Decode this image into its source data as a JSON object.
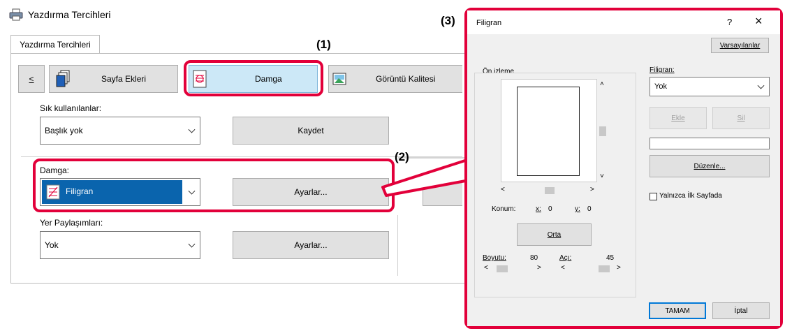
{
  "left_window": {
    "title": "Yazdırma Tercihleri",
    "tab": "Yazdırma Tercihleri",
    "nav_back": "<",
    "tool_tabs": [
      "Sayfa Ekleri",
      "Damga",
      "Görüntü Kalitesi"
    ],
    "favorites_label": "Sık kullanılanlar:",
    "favorites_value": "Başlık yok",
    "save_button": "Kaydet",
    "stamp_label": "Damga:",
    "stamp_value": "Filigran",
    "stamp_settings_button": "Ayarlar...",
    "overlays_label": "Yer Paylaşımları:",
    "overlays_value": "Yok",
    "overlays_settings_button": "Ayarlar..."
  },
  "callouts": {
    "c1": "(1)",
    "c2": "(2)",
    "c3": "(3)"
  },
  "dialog": {
    "title": "Filigran",
    "help": "?",
    "close": "×",
    "defaults_button": "Varsayılanlar",
    "preview_label": "Ön izleme",
    "position_label": "Konum:",
    "x_label": "x:",
    "x_value": "0",
    "y_label": "y:",
    "y_value": "0",
    "center_button": "Orta",
    "size_label": "Boyutu:",
    "size_value": "80",
    "angle_label": "Açı:",
    "angle_value": "45",
    "watermark_label": "Filigran:",
    "watermark_value": "Yok",
    "add_button": "Ekle",
    "delete_button": "Sil",
    "edit_button": "Düzenle...",
    "first_page_only": "Yalnızca İlk Sayfada",
    "ok_button": "TAMAM",
    "cancel_button": "İptal"
  }
}
